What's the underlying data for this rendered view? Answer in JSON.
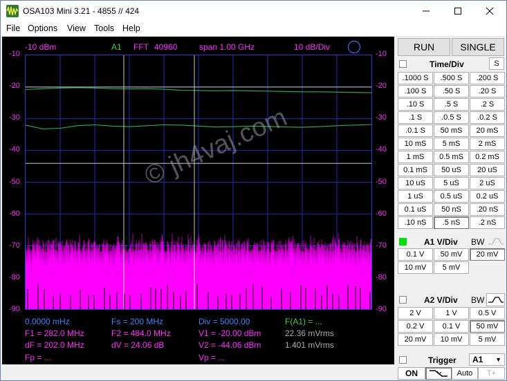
{
  "window": {
    "title": "OSA103 Mini 3.21  -  4855  //   424",
    "minimize_label": "—",
    "maximize_label": "☐",
    "close_label": "✕"
  },
  "menu": [
    "File",
    "Options",
    "View",
    "Tools",
    "Help"
  ],
  "scope": {
    "header": {
      "ref_level": "-10 dBm",
      "channel": "A1",
      "mode": "FFT",
      "points": "40960",
      "span": "span 1.00 GHz",
      "scale": "10 dB/Div"
    },
    "y_labels": [
      "-10",
      "-20",
      "-30",
      "-40",
      "-50",
      "-60",
      "-70",
      "-80",
      "-90"
    ],
    "watermark": "© jh4vaj.com",
    "info": {
      "row1": [
        "0.0000 mHz",
        "Fs = 200 MHz",
        "Div = 5000.00",
        "F(A1) = ..."
      ],
      "row2": [
        "F1 = 282.0 MHz",
        "F2 = 484.0 MHz",
        "V1 = -20.00 dBm",
        "22.36 mVrms"
      ],
      "row3": [
        "dF = 202.0 MHz",
        "dV = 24.06 dB",
        "V2 = -44.06 dBm",
        "1.401 mVrms"
      ],
      "row4": [
        "Fp = ...",
        "",
        "Vp = ...",
        ""
      ]
    }
  },
  "chart_data": {
    "type": "line",
    "y_unit": "dBm",
    "ylim": [
      -90,
      -10
    ],
    "y_ticks": [
      -10,
      -20,
      -30,
      -40,
      -50,
      -60,
      -70,
      -80,
      -90
    ],
    "x_range_label": "span 1.00 GHz",
    "cursors": {
      "F1": "282.0 MHz",
      "F2": "484.0 MHz",
      "V1": -20.0,
      "V2": -44.06
    },
    "series": [
      {
        "values": [
          -20.8,
          -20.5,
          -20.3,
          -20.2,
          -20.3,
          -20.5,
          -20.6,
          -20.5,
          -20.7,
          -21.0,
          -21.1,
          -21.2,
          -21.1,
          -21.2,
          -21.3,
          -21.4,
          -21.5,
          -21.5,
          -21.6,
          -21.7,
          -21.8
        ]
      },
      {
        "values": [
          -32.0,
          -33.2,
          -33.0,
          -32.2,
          -31.9,
          -32.3,
          -32.5,
          -32.2,
          -31.9,
          -32.0,
          -32.3,
          -32.6,
          -32.5,
          -32.3,
          -32.4,
          -32.6,
          -32.7,
          -32.5,
          -32.2,
          -32.0,
          -31.8
        ]
      },
      {
        "noise_floor_top": -70,
        "noise_floor_median": -77
      }
    ],
    "colors": {
      "trace": "#2db34a",
      "noise": "#ff00ff",
      "grid": "#1e2fb4",
      "cursor": "#c8c8c8"
    }
  },
  "controls": {
    "run_label": "RUN",
    "single_label": "SINGLE",
    "time_div_title": "Time/Div",
    "time_div_s_label": "S",
    "time_buttons": [
      [
        ".1000 S",
        ".500 S",
        ".200 S"
      ],
      [
        ".100 S",
        ".50 S",
        ".20 S"
      ],
      [
        ".10 S",
        ".5 S",
        ".2 S"
      ],
      [
        ".1 S",
        ".0.5 S",
        ".0.2 S"
      ],
      [
        ".0.1 S",
        "50 mS",
        "20 mS"
      ],
      [
        "10 mS",
        "5 mS",
        "2 mS"
      ],
      [
        "1 mS",
        "0.5 mS",
        "0.2 mS"
      ],
      [
        "0.1 mS",
        "50 uS",
        "20 uS"
      ],
      [
        "10 uS",
        "5 uS",
        "2 uS"
      ],
      [
        "1 uS",
        "0.5 uS",
        "0.2 uS"
      ],
      [
        "0.1 uS",
        "50 nS",
        ".20 nS"
      ],
      [
        ".10 nS",
        ".5 nS",
        ".2 nS"
      ]
    ],
    "time_selected": ".5 nS",
    "a1_title": "A1 V/Div",
    "a1_bw": "BW",
    "a1_buttons": [
      [
        "0.1 V",
        "50 mV",
        "20 mV"
      ],
      [
        "10 mV",
        "5 mV",
        ""
      ]
    ],
    "a1_selected": "20 mV",
    "a1_color": "#00dd00",
    "a2_title": "A2 V/Div",
    "a2_bw": "BW",
    "a2_buttons": [
      [
        "2 V",
        "1 V",
        "0.5 V"
      ],
      [
        "0.2 V",
        "0.1 V",
        "50 mV"
      ],
      [
        "20 mV",
        "10 mV",
        "5 mV"
      ]
    ],
    "a2_selected": "50 mV",
    "trigger_title": "Trigger",
    "trigger_source": "A1",
    "on_label": "ON",
    "auto_label": "Auto",
    "tplus_label": "T+"
  }
}
